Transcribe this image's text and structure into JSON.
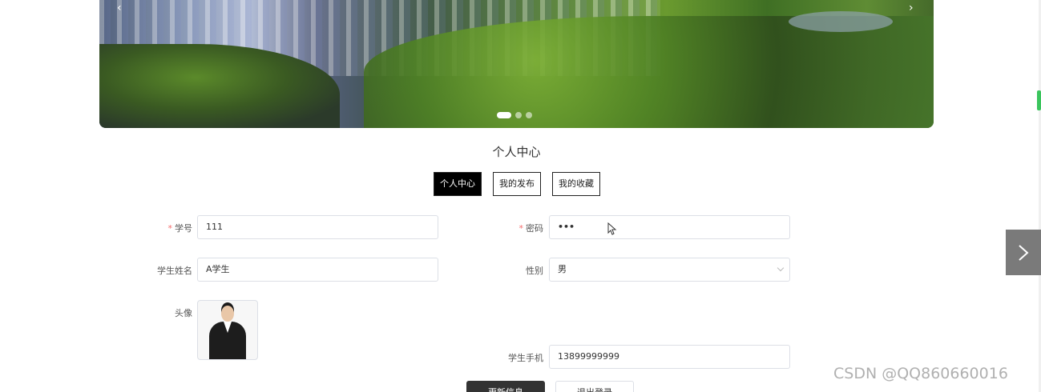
{
  "banner": {
    "prev_icon": "‹",
    "next_icon": "›",
    "dot_count": 3,
    "active_dot": 0
  },
  "page": {
    "title": "个人中心"
  },
  "tabs": [
    {
      "label": "个人中心",
      "active": true
    },
    {
      "label": "我的发布",
      "active": false
    },
    {
      "label": "我的收藏",
      "active": false
    }
  ],
  "form": {
    "student_id": {
      "label": "学号",
      "required": true,
      "value": "111"
    },
    "password": {
      "label": "密码",
      "required": true,
      "value": "•••"
    },
    "student_name": {
      "label": "学生姓名",
      "value": "A学生"
    },
    "gender": {
      "label": "性别",
      "value": "男"
    },
    "avatar": {
      "label": "头像"
    },
    "phone": {
      "label": "学生手机",
      "value": "13899999999"
    }
  },
  "buttons": {
    "update": "更新信息",
    "logout": "退出登录"
  },
  "watermark": "CSDN @QQ860660016",
  "colors": {
    "tab_active_bg": "#000000",
    "required_star": "#f56c6c",
    "primary_button": "#333333",
    "side_arrow_bg": "#7a7a7a"
  }
}
